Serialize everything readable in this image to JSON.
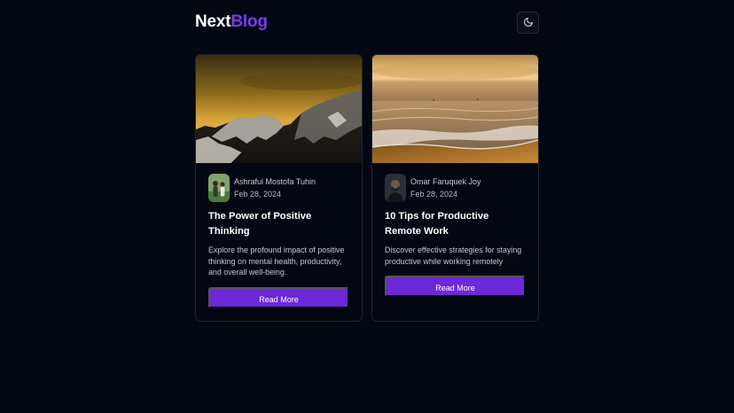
{
  "header": {
    "logo_part1": "Next",
    "logo_part2": "Blog",
    "theme_toggle_icon": "moon-icon"
  },
  "posts": [
    {
      "image": "mountain-sunset-photo",
      "author": "Ashraful Mostofa Tuhin",
      "date": "Feb 28, 2024",
      "title": "The Power of Positive Thinking",
      "excerpt": "Explore the profound impact of positive thinking on mental health, productivity, and overall well-being.",
      "button_label": "Read More"
    },
    {
      "image": "beach-sunset-photo",
      "author": "Omar Faruquek Joy",
      "date": "Feb 28, 2024",
      "title": "10 Tips for Productive Remote Work",
      "excerpt": "Discover effective strategies for staying productive while working remotely",
      "button_label": "Read More"
    }
  ],
  "colors": {
    "background": "#030712",
    "accent": "#6d28d9",
    "logo_accent": "#7c3aed",
    "card_border": "#1f2430"
  }
}
